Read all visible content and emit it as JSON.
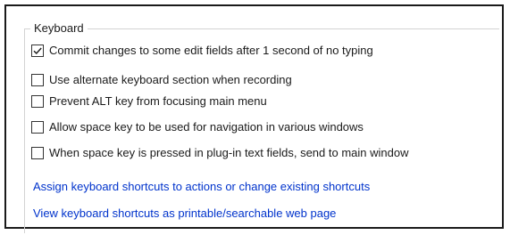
{
  "group": {
    "title": "Keyboard"
  },
  "options": [
    {
      "label": "Commit changes to some edit fields after 1 second of no typing",
      "checked": true
    },
    {
      "label": "Use alternate keyboard section when recording",
      "checked": false
    },
    {
      "label": "Prevent ALT key from focusing main menu",
      "checked": false
    },
    {
      "label": "Allow space key to be used for navigation in various windows",
      "checked": false
    },
    {
      "label": "When space key is pressed in plug-in text fields, send to main window",
      "checked": false
    }
  ],
  "links": {
    "assign_shortcuts": "Assign keyboard shortcuts to actions or change existing shortcuts",
    "view_shortcuts": "View keyboard shortcuts as printable/searchable web page"
  },
  "colors": {
    "link": "#0033cc",
    "border": "#1a1a1a",
    "group_line": "#d3d3d3"
  }
}
